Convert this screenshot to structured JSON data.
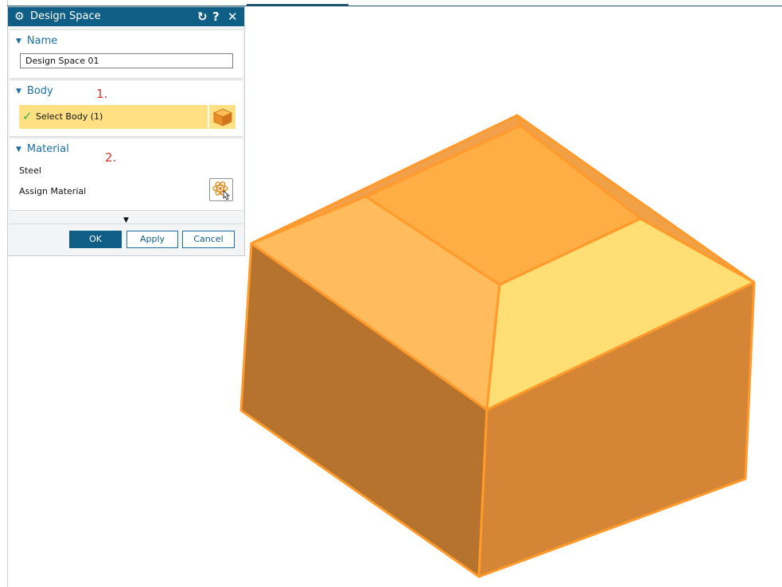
{
  "dialog": {
    "title": "Design Space",
    "title_icon": "gear-icon",
    "reset_glyph": "↻",
    "help_glyph": "?",
    "close_glyph": "✕"
  },
  "sections": {
    "name": {
      "header": "Name",
      "value": "Design Space 01"
    },
    "body": {
      "header": "Body",
      "select_label": "Select Body (1)",
      "annotation": "1."
    },
    "material": {
      "header": "Material",
      "annotation": "2.",
      "value": "Steel",
      "assign_label": "Assign Material"
    }
  },
  "buttons": {
    "ok": "OK",
    "apply": "Apply",
    "cancel": "Cancel"
  },
  "colors": {
    "accent": "#0f5e86",
    "selection": "#ffe083",
    "annotation": "#d23a2a",
    "body_top_center": "#ffad45",
    "body_top_left": "#ffbb5c",
    "body_top_right": "#ffdf73",
    "body_top_back": "#f2a04a",
    "body_side_left": "#b5732d",
    "body_side_right": "#d48636",
    "body_edges": "#ff9a2b"
  }
}
